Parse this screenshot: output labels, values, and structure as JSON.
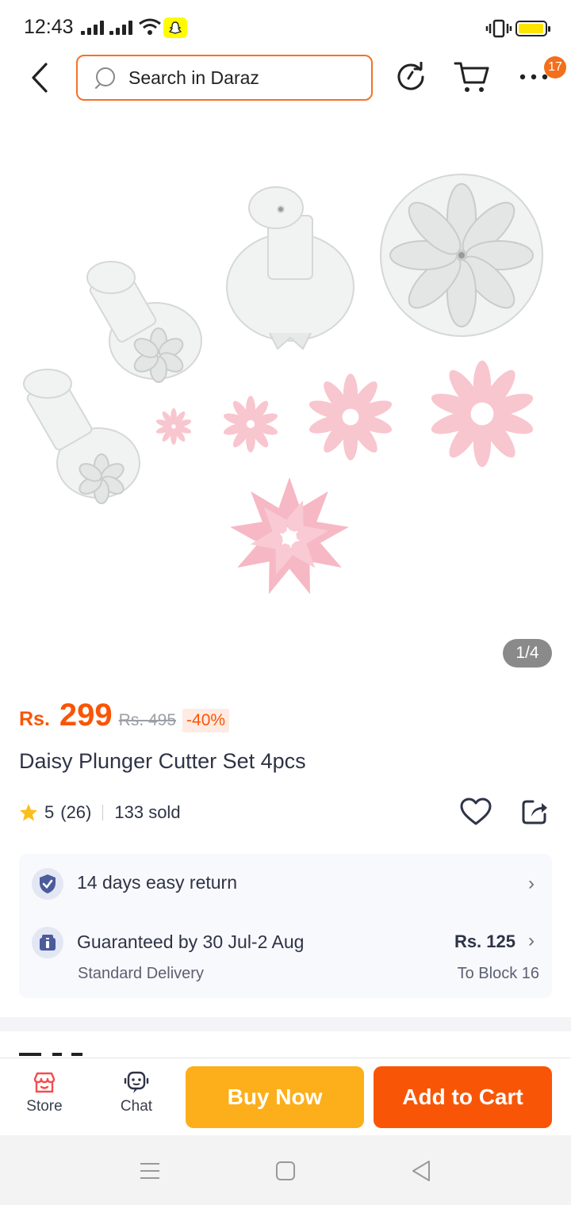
{
  "status_bar": {
    "time": "12:43"
  },
  "header": {
    "search_placeholder": "Search in Daraz",
    "notification_count": "17"
  },
  "gallery": {
    "counter": "1/4"
  },
  "price": {
    "currency": "Rs.",
    "current": "299",
    "original": "Rs. 495",
    "discount": "-40%"
  },
  "product": {
    "title": "Daisy Plunger Cutter Set 4pcs",
    "rating": "5",
    "review_count": "(26)",
    "sold": "133 sold"
  },
  "services": {
    "return_policy": "14 days easy return",
    "delivery_guarantee": "Guaranteed by 30 Jul-2 Aug",
    "delivery_type": "Standard Delivery",
    "delivery_fee": "Rs. 125",
    "delivery_location": "To Block 16"
  },
  "bottom_bar": {
    "store_label": "Store",
    "chat_label": "Chat",
    "buy_now_label": "Buy Now",
    "add_to_cart_label": "Add to Cart"
  },
  "colors": {
    "brand_orange": "#f85606",
    "buy_now_yellow": "#fcaf1a",
    "star_yellow": "#fbbf1b"
  }
}
